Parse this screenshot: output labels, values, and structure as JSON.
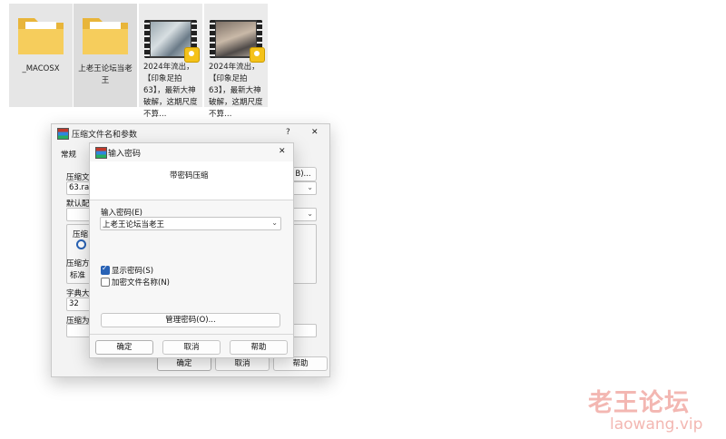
{
  "explorer": {
    "items": [
      {
        "label": "_MACOSX",
        "kind": "folder"
      },
      {
        "label": "上老王论坛当老王",
        "kind": "folder"
      },
      {
        "label": "2024年流出，【印象足拍63】，最新大神破解，这期尺度不算…",
        "kind": "video"
      },
      {
        "label": "2024年流出，【印象足拍63】，最新大神破解，这期尺度不算…",
        "kind": "video"
      }
    ]
  },
  "archive_dialog": {
    "title": "压缩文件名和参数",
    "help_char": "?",
    "close_char": "✕",
    "tab_general": "常规",
    "archive_name_label": "压缩文",
    "browse_button": "B)...",
    "archive_name_value": "63.rar",
    "default_profile_label": "默认配",
    "format_label": "压缩",
    "method_label": "压缩方",
    "method_value": "标准",
    "dict_label": "字典大",
    "dict_value": "32",
    "split_label": "压缩为",
    "ok": "确定",
    "cancel": "取消",
    "help": "帮助"
  },
  "password_dialog": {
    "title": "输入密码",
    "close_char": "✕",
    "heading": "带密码压缩",
    "password_label": "输入密码(E)",
    "password_value": "上老王论坛当老王",
    "show_password": "显示密码(S)",
    "show_password_checked": true,
    "encrypt_names": "加密文件名称(N)",
    "encrypt_names_checked": false,
    "organize_button": "管理密码(O)...",
    "ok": "确定",
    "cancel": "取消",
    "help": "帮助"
  },
  "watermark": {
    "cn": "老王论坛",
    "url": "laowang.vip"
  }
}
